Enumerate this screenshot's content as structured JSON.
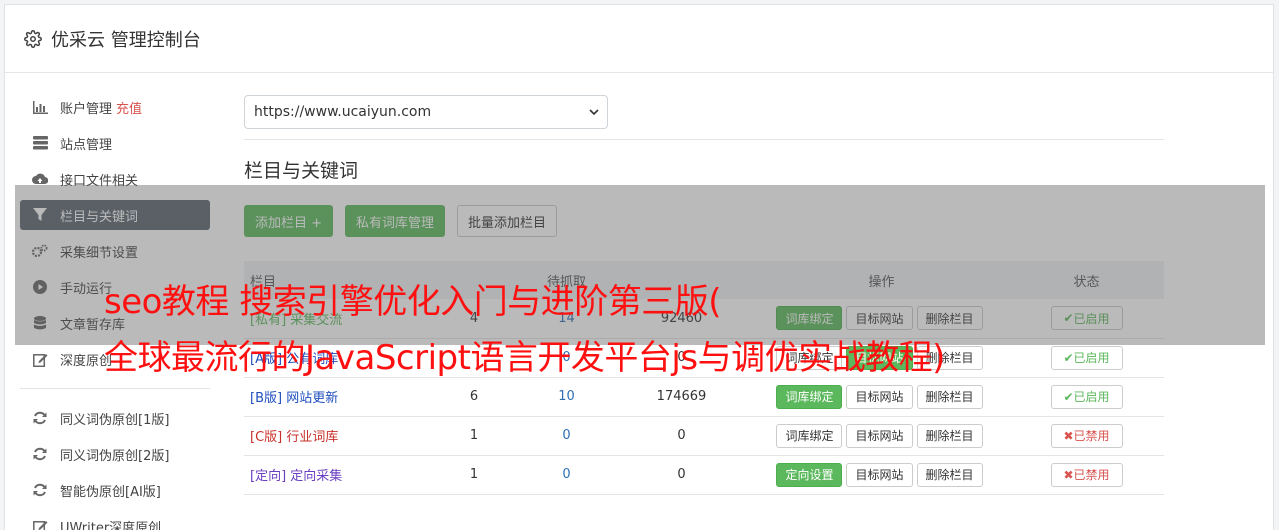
{
  "app": {
    "title": "优采云 管理控制台"
  },
  "sidebar": {
    "items": [
      {
        "label": "账户管理",
        "extra": "充值",
        "icon": "bar-chart-icon"
      },
      {
        "label": "站点管理",
        "icon": "server-icon"
      },
      {
        "label": "接口文件相关",
        "icon": "cloud-upload-icon"
      },
      {
        "label": "栏目与关键词",
        "icon": "filter-icon"
      },
      {
        "label": "采集细节设置",
        "icon": "cogs-icon"
      },
      {
        "label": "手动运行",
        "icon": "play-icon"
      },
      {
        "label": "文章暂存库",
        "icon": "database-icon"
      },
      {
        "label": "深度原创",
        "icon": "edit-icon"
      }
    ],
    "items2": [
      {
        "label": "同义词伪原创[1版]",
        "icon": "refresh-icon"
      },
      {
        "label": "同义词伪原创[2版]",
        "icon": "refresh-icon"
      },
      {
        "label": "智能伪原创[AI版]",
        "icon": "refresh-icon"
      },
      {
        "label": "UWriter深度原创",
        "icon": "edit-icon"
      }
    ]
  },
  "main": {
    "site_select": "https://www.ucaiyun.com",
    "section_title": "栏目与关键词",
    "buttons": {
      "add_column": "添加栏目 +",
      "private_lib": "私有词库管理",
      "batch_add": "批量添加栏目"
    },
    "table": {
      "headers": [
        "栏目",
        "",
        "待抓取",
        "",
        "操作",
        "状态"
      ],
      "rows": [
        {
          "tag": "[私有]",
          "name": "采集交流",
          "c1": "4",
          "c2": "14",
          "c3": "92460",
          "op1": "词库绑定",
          "op2": "目标网站",
          "op3": "删除栏目",
          "status": "已启用"
        },
        {
          "tag": "[A版]",
          "name": "公有词库",
          "c1": "",
          "c2": "0",
          "c3": "0",
          "op1": "词库绑定",
          "op2": "目标网站",
          "op3": "删除栏目",
          "status": "已启用"
        },
        {
          "tag": "[B版]",
          "name": "网站更新",
          "c1": "6",
          "c2": "10",
          "c3": "174669",
          "op1": "词库绑定",
          "op2": "目标网站",
          "op3": "删除栏目",
          "status": "已启用"
        },
        {
          "tag": "[C版]",
          "name": "行业词库",
          "c1": "1",
          "c2": "0",
          "c3": "0",
          "op1": "词库绑定",
          "op2": "目标网站",
          "op3": "删除栏目",
          "status": "已禁用"
        },
        {
          "tag": "[定向]",
          "name": "定向采集",
          "c1": "1",
          "c2": "0",
          "c3": "0",
          "op1": "定向设置",
          "op2": "目标网站",
          "op3": "删除栏目",
          "status": "已禁用"
        }
      ]
    }
  },
  "overlay": {
    "line1": "seo教程 搜索引擎优化入门与进阶第三版(",
    "line2": "全球最流行的JavaScript语言开发平台js与调优实战教程)"
  },
  "colors": {
    "accent_green": "#5cb85c",
    "active_nav": "#5c6570",
    "danger": "#d9534f",
    "overlay_text": "#ff1010"
  }
}
